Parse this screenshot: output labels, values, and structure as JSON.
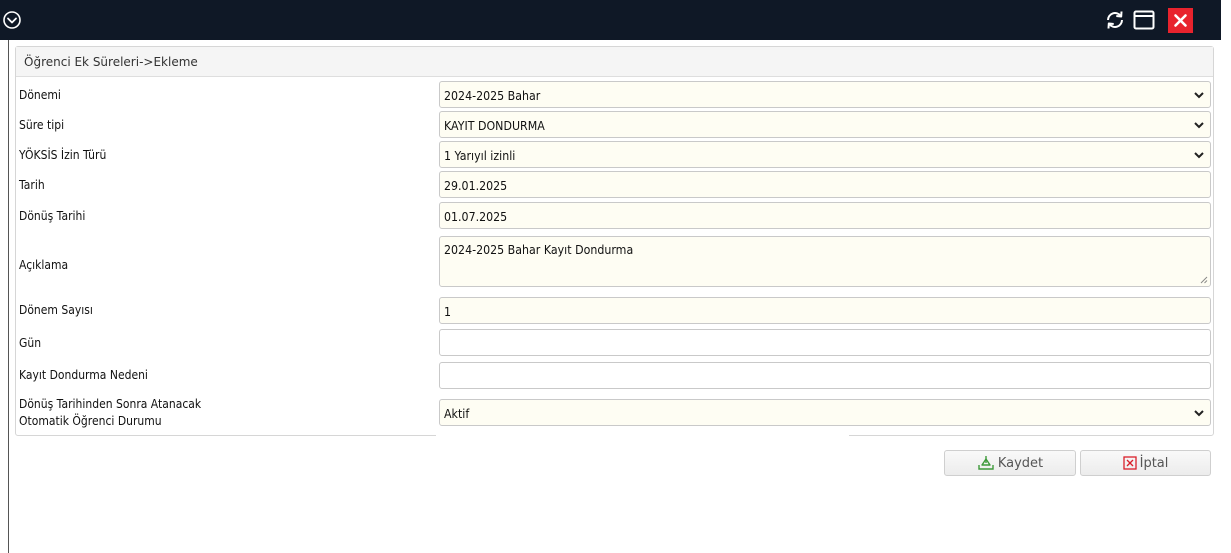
{
  "colors": {
    "titlebar": "#0f1826",
    "close_button": "#e8232d",
    "field_bg": "#fefdf3",
    "cancel_icon": "#d9202a",
    "save_icon": "#3e9a3a"
  },
  "panel": {
    "title": "Öğrenci Ek Süreleri->Ekleme"
  },
  "form": {
    "donemi": {
      "label": "Dönemi",
      "value": "2024-2025 Bahar"
    },
    "sure_tipi": {
      "label": "Süre tipi",
      "value": "KAYIT DONDURMA"
    },
    "yoksis": {
      "label": "YÖKSİS İzin Türü",
      "value": "1 Yarıyıl izinli"
    },
    "tarih": {
      "label": "Tarih",
      "value": "29.01.2025"
    },
    "donus_tarihi": {
      "label": "Dönüş Tarihi",
      "value": "01.07.2025"
    },
    "aciklama": {
      "label": "Açıklama",
      "value": "2024-2025 Bahar Kayıt Dondurma"
    },
    "donem_sayisi": {
      "label": "Dönem Sayısı",
      "value": "1"
    },
    "gun": {
      "label": "Gün",
      "value": ""
    },
    "kayit_dondurma_nedeni": {
      "label": "Kayıt Dondurma Nedeni",
      "value": ""
    },
    "otomatik_durum": {
      "label_line1": "Dönüş Tarihinden Sonra Atanacak",
      "label_line2": "Otomatik Öğrenci Durumu",
      "value": "Aktif"
    }
  },
  "buttons": {
    "save_label": "Kaydet",
    "cancel_label": "İptal"
  },
  "icons": {
    "titlebar": [
      "chevron-circle-down-icon",
      "refresh-icon",
      "maximize-icon",
      "close-icon"
    ],
    "buttons": [
      "save-icon",
      "cancel-icon"
    ],
    "select": "chevron-down-icon"
  }
}
